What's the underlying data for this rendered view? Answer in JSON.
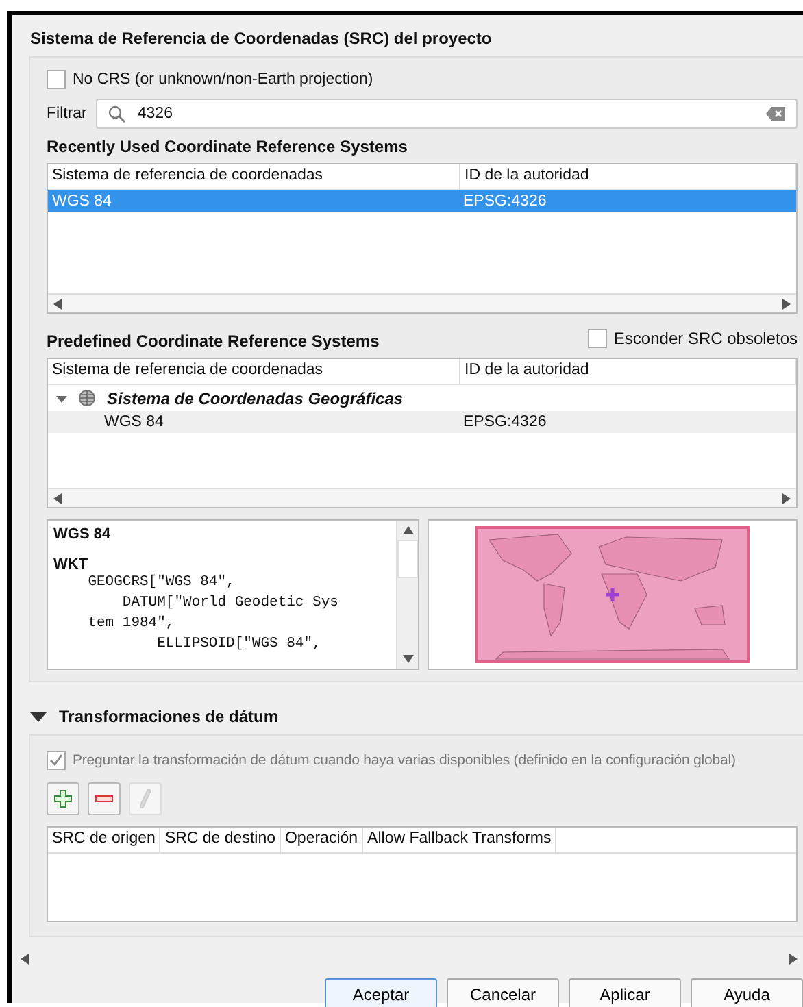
{
  "crs_section": {
    "title": "Sistema de Referencia de Coordenadas (SRC) del proyecto",
    "no_crs": {
      "label": "No CRS (or unknown/non-Earth projection)",
      "checked": false
    },
    "filter": {
      "label": "Filtrar",
      "value": "4326"
    },
    "recent": {
      "title": "Recently Used Coordinate Reference Systems",
      "columns": [
        "Sistema de referencia de coordenadas",
        "ID de la autoridad"
      ],
      "rows": [
        {
          "name": "WGS 84",
          "id": "EPSG:4326",
          "selected": true
        }
      ]
    },
    "predefined": {
      "title": "Predefined Coordinate Reference Systems",
      "hide_deprecated": {
        "label": "Esconder SRC obsoletos",
        "checked": false
      },
      "columns": [
        "Sistema de referencia de coordenadas",
        "ID de la autoridad"
      ],
      "tree": [
        {
          "label": "Sistema de Coordenadas Geográficas",
          "expanded": true,
          "children": [
            {
              "name": "WGS 84",
              "id": "EPSG:4326",
              "selected": false
            }
          ]
        }
      ]
    },
    "details": {
      "name": "WGS 84",
      "wkt_label": "WKT",
      "wkt_lines": [
        "    GEOGCRS[\"WGS 84\",",
        "        DATUM[\"World Geodetic Sys",
        "    tem 1984\",",
        "            ELLIPSOID[\"WGS 84\","
      ]
    }
  },
  "datum_section": {
    "title": "Transformaciones de dátum",
    "expanded": true,
    "ask": {
      "label": "Preguntar la transformación de dátum cuando haya varias disponibles (definido en la configuración global)",
      "checked": true,
      "disabled": true
    },
    "columns": [
      "SRC de origen",
      "SRC de destino",
      "Operación",
      "Allow Fallback Transforms"
    ]
  },
  "buttons": [
    {
      "label": "Aceptar",
      "default": true
    },
    {
      "label": "Cancelar",
      "default": false
    },
    {
      "label": "Aplicar",
      "default": false
    },
    {
      "label": "Ayuda",
      "default": false
    }
  ]
}
